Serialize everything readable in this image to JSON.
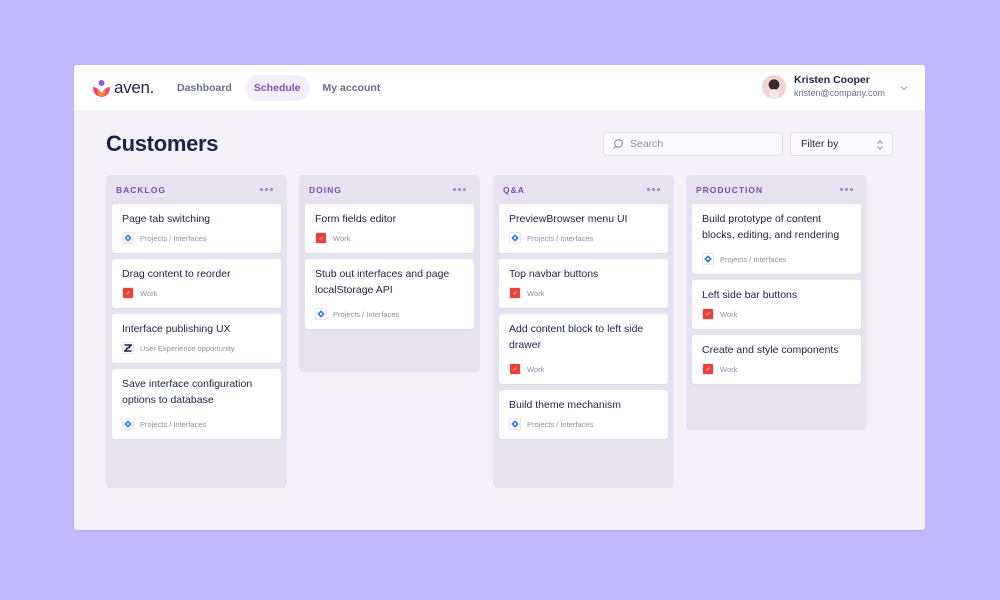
{
  "app": {
    "brand": "aven.",
    "colors": {
      "accent": "#7a4fb0",
      "background": "#c2b8fd",
      "column": "#e7e2f0"
    }
  },
  "nav": {
    "items": [
      {
        "label": "Dashboard",
        "active": false
      },
      {
        "label": "Schedule",
        "active": true
      },
      {
        "label": "My account",
        "active": false
      }
    ]
  },
  "user": {
    "name": "Kristen Cooper",
    "email": "kristen@company.com"
  },
  "page": {
    "title": "Customers"
  },
  "toolbar": {
    "search_placeholder": "Search",
    "search_value": "",
    "filter_label": "Filter by"
  },
  "columns": [
    {
      "title": "BACKLOG",
      "cards": [
        {
          "title": "Page tab switching",
          "tag": "Projects / Interfaces",
          "icon": "projects-icon"
        },
        {
          "title": "Drag content to reorder",
          "tag": "Work",
          "icon": "work-icon"
        },
        {
          "title": "Interface publishing UX",
          "tag": "User Experience opportunity",
          "icon": "ux-icon"
        },
        {
          "title": "Save interface configuration options to database",
          "tag": "Projects / Interfaces",
          "icon": "projects-icon"
        }
      ]
    },
    {
      "title": "DOING",
      "cards": [
        {
          "title": "Form fields editor",
          "tag": "Work",
          "icon": "work-icon"
        },
        {
          "title": "Stub out interfaces and page localStorage API",
          "tag": "Projects / Interfaces",
          "icon": "projects-icon"
        }
      ]
    },
    {
      "title": "Q&A",
      "cards": [
        {
          "title": "PreviewBrowser menu UI",
          "tag": "Projects / Interfaces",
          "icon": "projects-icon"
        },
        {
          "title": "Top navbar buttons",
          "tag": "Work",
          "icon": "work-icon"
        },
        {
          "title": "Add content block to left side drawer",
          "tag": "Work",
          "icon": "work-icon"
        },
        {
          "title": "Build theme mechanism",
          "tag": "Projects / Interfaces",
          "icon": "projects-icon"
        }
      ]
    },
    {
      "title": "PRODUCTION",
      "cards": [
        {
          "title": "Build prototype of content blocks, editing, and rendering",
          "tag": "Projects / Interfaces",
          "icon": "projects-icon"
        },
        {
          "title": "Left side bar buttons",
          "tag": "Work",
          "icon": "work-icon"
        },
        {
          "title": "Create and style components",
          "tag": "Work",
          "icon": "work-icon"
        }
      ]
    }
  ]
}
